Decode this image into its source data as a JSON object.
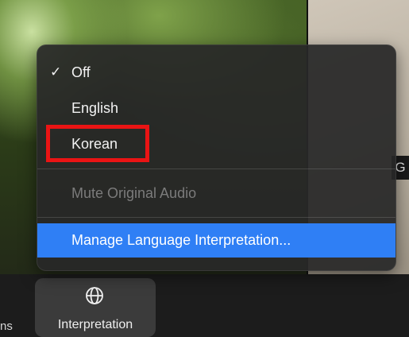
{
  "toolbar": {
    "partial_label": "ns",
    "interpretation_button": {
      "label": "Interpretation",
      "icon": "globe-icon"
    }
  },
  "right_tile": {
    "label": "G"
  },
  "menu": {
    "items": [
      {
        "label": "Off",
        "checked": true
      },
      {
        "label": "English",
        "checked": false
      },
      {
        "label": "Korean",
        "checked": false,
        "annotated": true
      }
    ],
    "mute_original_audio": {
      "label": "Mute Original Audio",
      "enabled": false
    },
    "manage": {
      "label": "Manage Language Interpretation...",
      "highlighted": true
    }
  },
  "colors": {
    "highlight": "#2f7ff5",
    "annotation": "#ea1414"
  }
}
